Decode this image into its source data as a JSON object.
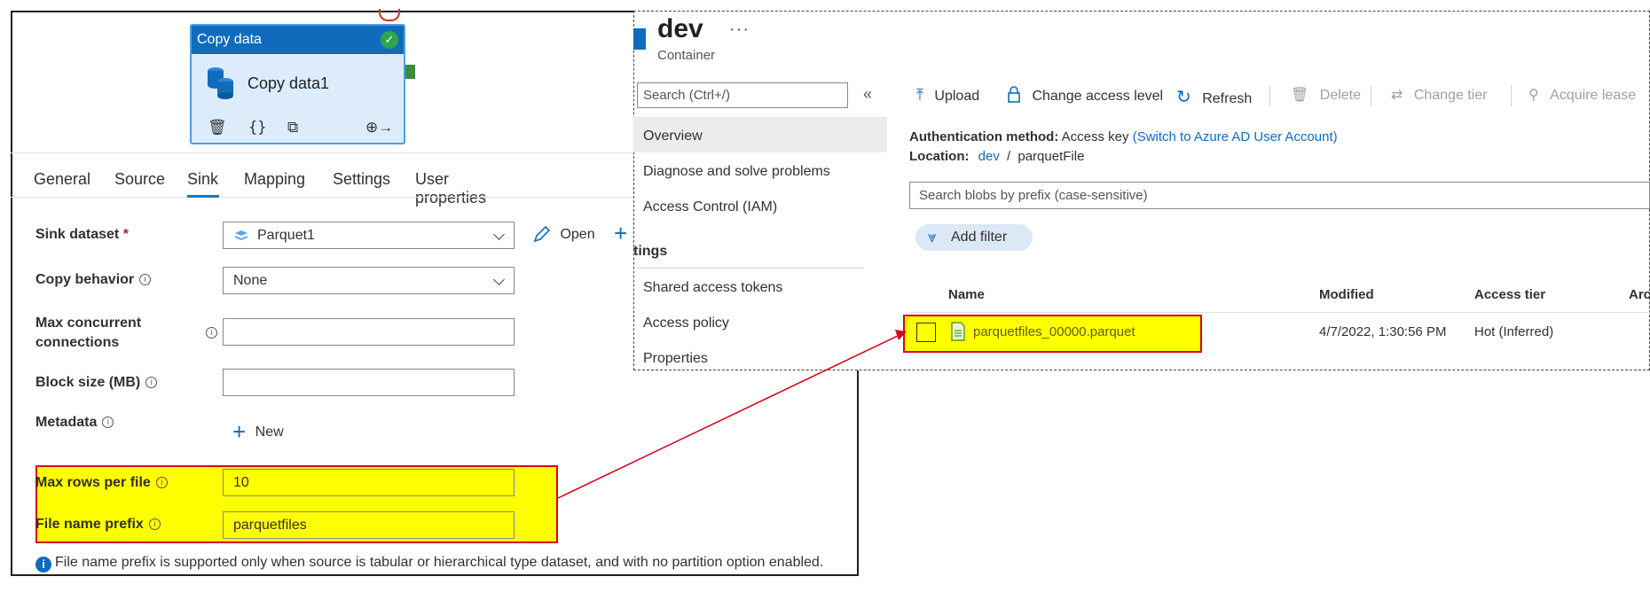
{
  "activity": {
    "header": "Copy data",
    "name": "Copy data1"
  },
  "tabs": [
    "General",
    "Source",
    "Sink",
    "Mapping",
    "Settings",
    "User properties"
  ],
  "active_tab": "Sink",
  "form": {
    "sink_dataset_label": "Sink dataset",
    "required_mark": "*",
    "sink_dataset_value": "Parquet1",
    "open_label": "Open",
    "copy_behavior_label": "Copy behavior",
    "copy_behavior_value": "None",
    "max_conn_label_1": "Max concurrent",
    "max_conn_label_2": "connections",
    "block_size_label": "Block size (MB)",
    "metadata_label": "Metadata",
    "new_label": "New",
    "max_rows_label": "Max rows per file",
    "max_rows_value": "10",
    "prefix_label": "File name prefix",
    "prefix_value": "parquetfiles"
  },
  "note": "File name prefix is supported only when source is tabular or hierarchical type dataset, and with no partition option enabled.",
  "container": {
    "title": "dev",
    "subtitle": "Container",
    "more": "···"
  },
  "nav": {
    "search_placeholder": "Search (Ctrl+/)",
    "collapse": "«",
    "items_top": [
      "Overview",
      "Diagnose and solve problems",
      "Access Control (IAM)"
    ],
    "section": "tings",
    "items_bottom": [
      "Shared access tokens",
      "Access policy",
      "Properties"
    ]
  },
  "toolbar": {
    "upload": "Upload",
    "change_access": "Change access level",
    "refresh": "Refresh",
    "delete": "Delete",
    "change_tier": "Change tier",
    "acquire_lease": "Acquire lease"
  },
  "details": {
    "auth_label": "Authentication method:",
    "auth_value": "Access key",
    "auth_link": "(Switch to Azure AD User Account)",
    "location_label": "Location:",
    "location_link": "dev",
    "location_sep": "/",
    "location_folder": "parquetFile"
  },
  "blob_search_placeholder": "Search blobs by prefix (case-sensitive)",
  "add_filter": "Add filter",
  "columns": [
    "Name",
    "Modified",
    "Access tier",
    "Arc"
  ],
  "files": [
    {
      "name": "parquetfiles_00000.parquet",
      "modified": "4/7/2022, 1:30:56 PM",
      "tier": "Hot (Inferred)"
    }
  ],
  "colors": {
    "accent": "#0f6cbd",
    "highlight": "#ffff00",
    "annotation": "#d9001b"
  }
}
